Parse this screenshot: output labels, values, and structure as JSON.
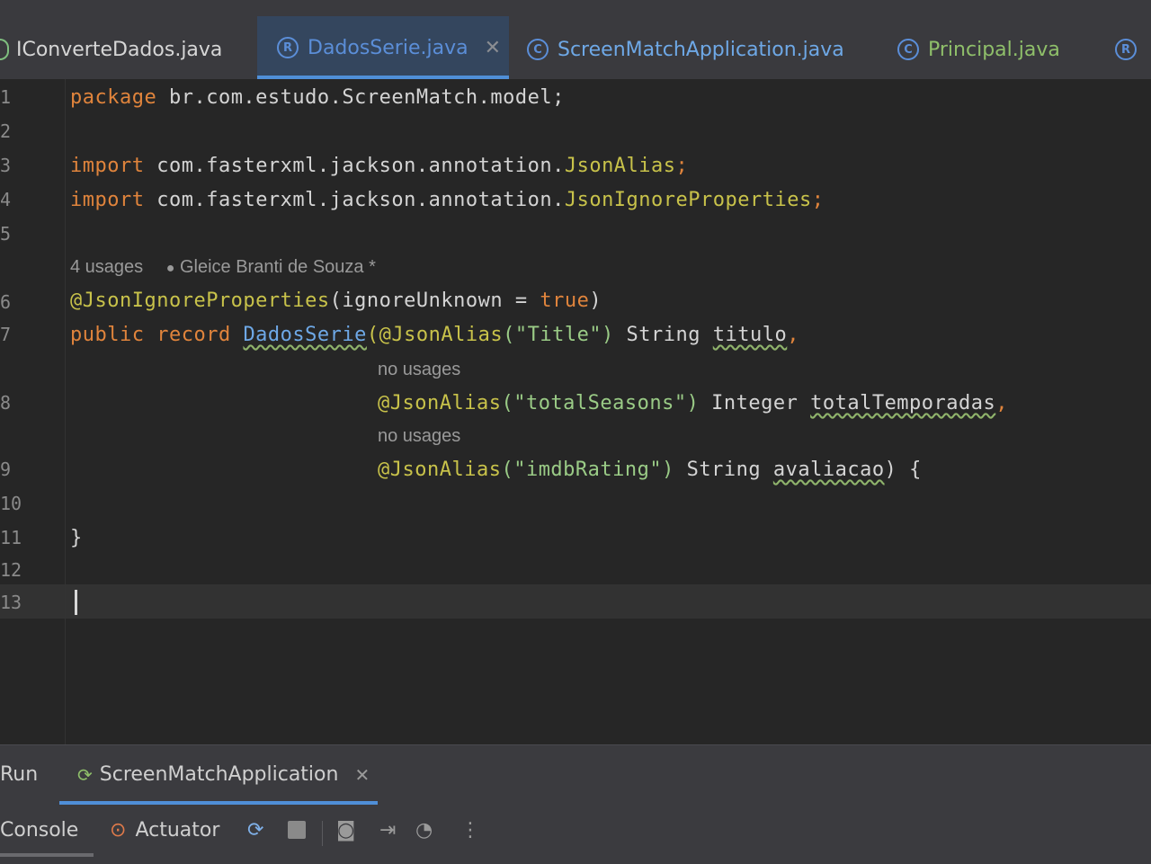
{
  "tabs": [
    {
      "label": "IConverteDados.java",
      "icon": "interface-icon"
    },
    {
      "label": "DadosSerie.java",
      "icon": "record-icon",
      "active": true
    },
    {
      "label": "ScreenMatchApplication.java",
      "icon": "class-run-icon"
    },
    {
      "label": "Principal.java",
      "icon": "class-icon"
    }
  ],
  "editor": {
    "line_numbers": [
      "1",
      "2",
      "3",
      "4",
      "5",
      "6",
      "7",
      "8",
      "9",
      "10",
      "11",
      "12",
      "13"
    ],
    "lines": {
      "l1_kw": "package",
      "l1_rest": " br.com.estudo.ScreenMatch.model;",
      "l3_kw": "import",
      "l3_rest": " com.fasterxml.jackson.annotation.",
      "l3_cls": "JsonAlias",
      "l3_end": ";",
      "l4_kw": "import",
      "l4_rest": " com.fasterxml.jackson.annotation.",
      "l4_cls": "JsonIgnoreProperties",
      "l4_end": ";",
      "hint_usages": "4 usages",
      "hint_author": "Gleice Branti de Souza *",
      "l6_ann": "@JsonIgnoreProperties",
      "l6_rest": "(ignoreUnknown = ",
      "l6_kw": "true",
      "l6_end": ")",
      "l7_kw": "public record",
      "l7_name": "DadosSerie",
      "l7_ann": "(@JsonAlias",
      "l7_str": "(\"Title\")",
      "l7_type": " String ",
      "l7_var": "titulo",
      "l7_end": ",",
      "hint_no_usages_1": "no usages",
      "l8_ann": "@JsonAlias",
      "l8_str": "(\"totalSeasons\")",
      "l8_type": " Integer ",
      "l8_var": "totalTemporadas",
      "l8_end": ",",
      "hint_no_usages_2": "no usages",
      "l9_ann": "@JsonAlias",
      "l9_str": "(\"imdbRating\")",
      "l9_type": " String ",
      "l9_var": "avaliacao",
      "l9_end": ") {",
      "l11": "}"
    }
  },
  "run_panel": {
    "label": "Run",
    "tab_label": "ScreenMatchApplication",
    "console_label": "Console",
    "actuator_label": "Actuator"
  },
  "colors": {
    "keyword": "#e0843c",
    "annotation": "#c8c24a",
    "accent": "#4f8fd8"
  }
}
